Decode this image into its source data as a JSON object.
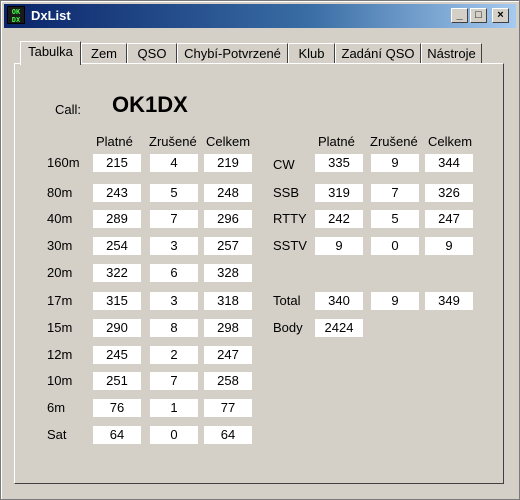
{
  "window": {
    "title": "DxList",
    "icon_text": "OK1DX"
  },
  "tabs": [
    "Tabulka",
    "Zem",
    "QSO",
    "Chybí-Potvrzené",
    "Klub",
    "Zadání QSO",
    "Nástroje"
  ],
  "call": {
    "label": "Call:",
    "value": "OK1DX"
  },
  "headers": {
    "valid": "Platné",
    "cancelled": "Zrušené",
    "total": "Celkem"
  },
  "bands": [
    {
      "name": "160m",
      "valid": "215",
      "cancelled": "4",
      "total": "219"
    },
    {
      "name": "80m",
      "valid": "243",
      "cancelled": "5",
      "total": "248"
    },
    {
      "name": "40m",
      "valid": "289",
      "cancelled": "7",
      "total": "296"
    },
    {
      "name": "30m",
      "valid": "254",
      "cancelled": "3",
      "total": "257"
    },
    {
      "name": "20m",
      "valid": "322",
      "cancelled": "6",
      "total": "328"
    },
    {
      "name": "17m",
      "valid": "315",
      "cancelled": "3",
      "total": "318"
    },
    {
      "name": "15m",
      "valid": "290",
      "cancelled": "8",
      "total": "298"
    },
    {
      "name": "12m",
      "valid": "245",
      "cancelled": "2",
      "total": "247"
    },
    {
      "name": "10m",
      "valid": "251",
      "cancelled": "7",
      "total": "258"
    },
    {
      "name": "6m",
      "valid": "76",
      "cancelled": "1",
      "total": "77"
    },
    {
      "name": "Sat",
      "valid": "64",
      "cancelled": "0",
      "total": "64"
    }
  ],
  "modes": [
    {
      "name": "CW",
      "valid": "335",
      "cancelled": "9",
      "total": "344"
    },
    {
      "name": "SSB",
      "valid": "319",
      "cancelled": "7",
      "total": "326"
    },
    {
      "name": "RTTY",
      "valid": "242",
      "cancelled": "5",
      "total": "247"
    },
    {
      "name": "SSTV",
      "valid": "9",
      "cancelled": "0",
      "total": "9"
    }
  ],
  "totals": {
    "name": "Total",
    "valid": "340",
    "cancelled": "9",
    "total": "349"
  },
  "points": {
    "name": "Body",
    "value": "2424"
  }
}
